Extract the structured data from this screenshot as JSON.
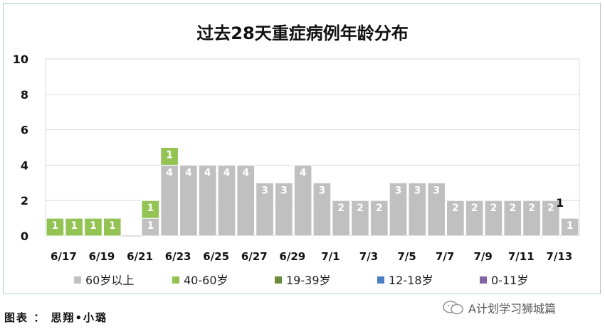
{
  "chart_data": {
    "type": "bar",
    "stacked": true,
    "title": "过去28天重症病例年龄分布",
    "xlabel": "",
    "ylabel": "",
    "ylim": [
      0,
      10
    ],
    "yticks": [
      0,
      2,
      4,
      6,
      8,
      10
    ],
    "grid": "horizontal",
    "legend": "bottom",
    "categories": [
      "6/17",
      "6/18",
      "6/19",
      "6/20",
      "6/21",
      "6/22",
      "6/23",
      "6/24",
      "6/25",
      "6/26",
      "6/27",
      "6/28",
      "6/29",
      "6/30",
      "7/1",
      "7/2",
      "7/3",
      "7/4",
      "7/5",
      "7/6",
      "7/7",
      "7/8",
      "7/9",
      "7/10",
      "7/11",
      "7/12",
      "7/13",
      "7/14"
    ],
    "tick_labels": [
      "6/17",
      "",
      "6/19",
      "",
      "6/21",
      "",
      "6/23",
      "",
      "6/25",
      "",
      "6/27",
      "",
      "6/29",
      "",
      "7/1",
      "",
      "7/3",
      "",
      "7/5",
      "",
      "7/7",
      "",
      "7/9",
      "",
      "7/11",
      "",
      "7/13",
      ""
    ],
    "series": [
      {
        "name": "60岁以上",
        "color": "#c0c0c0",
        "values": [
          0,
          0,
          0,
          0,
          0,
          1,
          4,
          4,
          4,
          4,
          4,
          3,
          3,
          4,
          3,
          2,
          2,
          2,
          3,
          3,
          3,
          2,
          2,
          2,
          2,
          2,
          2,
          1
        ]
      },
      {
        "name": "40-60岁",
        "color": "#92c353",
        "values": [
          1,
          1,
          1,
          1,
          0,
          1,
          1,
          0,
          0,
          0,
          0,
          0,
          0,
          0,
          0,
          0,
          0,
          0,
          0,
          0,
          0,
          0,
          0,
          0,
          0,
          0,
          0,
          0
        ]
      },
      {
        "name": "19-39岁",
        "color": "#6a8c3a",
        "values": [
          0,
          0,
          0,
          0,
          0,
          0,
          0,
          0,
          0,
          0,
          0,
          0,
          0,
          0,
          0,
          0,
          0,
          0,
          0,
          0,
          0,
          0,
          0,
          0,
          0,
          0,
          0,
          0
        ]
      },
      {
        "name": "12-18岁",
        "color": "#4a7fc1",
        "values": [
          0,
          0,
          0,
          0,
          0,
          0,
          0,
          0,
          0,
          0,
          0,
          0,
          0,
          0,
          0,
          0,
          0,
          0,
          0,
          0,
          0,
          0,
          0,
          0,
          0,
          0,
          0,
          0
        ]
      },
      {
        "name": "0-11岁",
        "color": "#8064a2",
        "values": [
          0,
          0,
          0,
          0,
          0,
          0,
          0,
          0,
          0,
          0,
          0,
          0,
          0,
          0,
          0,
          0,
          0,
          0,
          0,
          0,
          0,
          0,
          0,
          0,
          0,
          0,
          0,
          0
        ]
      }
    ],
    "totals_labels": [
      "",
      "",
      "",
      "",
      "",
      "",
      "",
      "",
      "",
      "",
      "",
      "",
      "",
      "",
      "",
      "",
      "",
      "",
      "",
      "",
      "",
      "",
      "",
      "",
      "",
      "",
      "",
      "1"
    ]
  },
  "footer": {
    "credit": "图表 ： 思翔•小璐"
  },
  "watermark": {
    "text": "A计划学习狮城篇",
    "icon": "wechat-icon"
  }
}
